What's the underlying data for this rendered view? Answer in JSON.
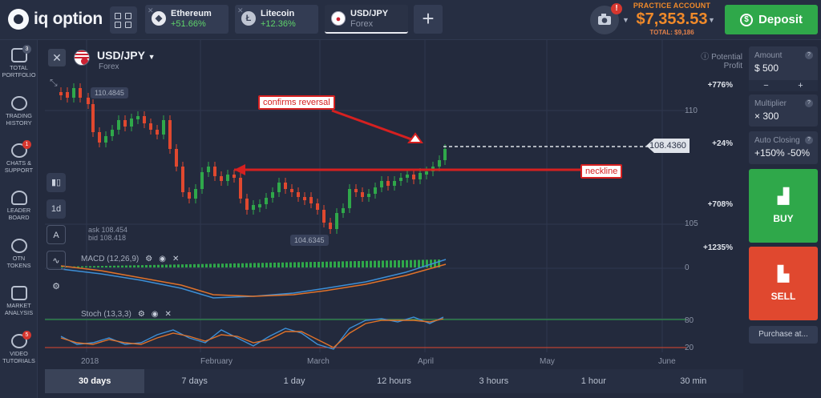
{
  "brand": {
    "name": "iq option"
  },
  "tabs": [
    {
      "name": "Ethereum",
      "change": "+51.66%",
      "icon": "ethereum-icon"
    },
    {
      "name": "Litecoin",
      "change": "+12.36%",
      "icon": "litecoin-icon"
    },
    {
      "name": "USD/JPY",
      "sub": "Forex",
      "icon": "usd-jpy-flag-icon"
    }
  ],
  "account": {
    "label": "PRACTICE ACCOUNT",
    "balance": "$7,353.53",
    "total": "TOTAL: $9,186"
  },
  "camera": {
    "alert": "!"
  },
  "deposit": {
    "label": "Deposit"
  },
  "sidebar": [
    {
      "label": "TOTAL PORTFOLIO",
      "badge": "3",
      "icon": "portfolio-icon"
    },
    {
      "label": "TRADING HISTORY",
      "badge": "",
      "icon": "history-icon"
    },
    {
      "label": "CHATS & SUPPORT",
      "badge": "1",
      "icon": "chat-icon"
    },
    {
      "label": "LEADER BOARD",
      "badge": "",
      "icon": "leaderboard-icon"
    },
    {
      "label": "OTN TOKENS",
      "badge": "",
      "icon": "token-icon"
    },
    {
      "label": "MARKET ANALYSIS",
      "badge": "",
      "icon": "analysis-icon"
    },
    {
      "label": "VIDEO TUTORIALS",
      "badge": "5",
      "icon": "video-icon"
    }
  ],
  "chart_header": {
    "symbol": "USD/JPY",
    "market": "Forex",
    "potential": "Potential Profit"
  },
  "tool_buttons": [
    "1d"
  ],
  "price_labels": {
    "high": "110.4845",
    "low": "104.6345",
    "current": "108.4360",
    "ask": "ask 108.454",
    "bid": "bid 108.418"
  },
  "profit_levels": [
    "+776%",
    "+24%",
    "+708%",
    "+1235%"
  ],
  "axis_ticks": [
    "110",
    "105"
  ],
  "annotations": {
    "reversal": "confirms reversal",
    "neckline": "neckline"
  },
  "indicators": {
    "macd": {
      "label": "MACD (12,26,9)",
      "zero": "0"
    },
    "stoch": {
      "label": "Stoch (13,3,3)",
      "upper": "80",
      "lower": "20"
    }
  },
  "x_labels": [
    "2018",
    "February",
    "March",
    "April",
    "May",
    "June"
  ],
  "timeframes": [
    "30 days",
    "7 days",
    "1 day",
    "12 hours",
    "3 hours",
    "1 hour",
    "30 min"
  ],
  "timeframe_active": "30 days",
  "right_panel": {
    "amount_label": "Amount",
    "amount_value": "$ 500",
    "minus": "−",
    "plus": "+",
    "multiplier_label": "Multiplier",
    "multiplier_value": "× 300",
    "autoclose_label": "Auto Closing",
    "autoclose_value": "+150% -50%",
    "buy": "BUY",
    "sell": "SELL",
    "purchase": "Purchase at..."
  },
  "colors": {
    "up": "#2fa84a",
    "down": "#e0482f",
    "accent": "#f08a2a",
    "annotation": "#d62020"
  }
}
